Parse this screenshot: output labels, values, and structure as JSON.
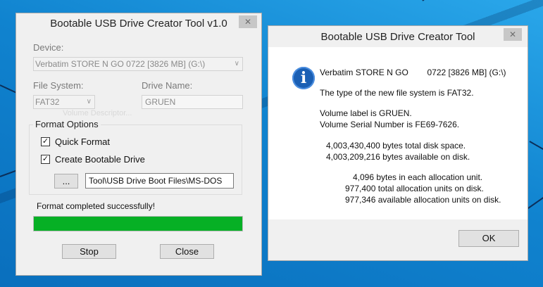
{
  "left_window": {
    "title": "Bootable USB Drive Creator Tool   v1.0",
    "close_glyph": "✕",
    "device_label": "Device:",
    "device_value": "Verbatim STORE N GO        0722 [3826 MB] (G:\\)",
    "filesystem_label": "File System:",
    "filesystem_value": "FAT32",
    "drive_name_label": "Drive Name:",
    "drive_name_value": "GRUEN",
    "ghost_text": "Volume Descriptor...",
    "format_options_title": "Format Options",
    "quick_format_label": "Quick Format",
    "quick_format_checked": true,
    "bootable_label": "Create Bootable Drive",
    "bootable_checked": true,
    "browse_label": "...",
    "boot_path": "Tool\\USB Drive Boot Files\\MS-DOS",
    "status_text": "Format completed successfully!",
    "progress": 1.0,
    "stop_label": "Stop",
    "close_label": "Close",
    "progress_color": "#06b025"
  },
  "right_window": {
    "title": "Bootable USB Drive Creator Tool",
    "close_glyph": "✕",
    "icon": "info-icon",
    "lines": {
      "device": "Verbatim STORE N GO        0722 [3826 MB] (G:\\)",
      "fs_type": "The type of the new file system is FAT32.",
      "volume_label": "Volume label is GRUEN.",
      "serial": "Volume Serial Number is FE69-7626.",
      "total_space": "4,003,430,400 bytes total disk space.",
      "available": "4,003,209,216 bytes available on disk.",
      "alloc_unit": "4,096 bytes in each allocation unit.",
      "total_units": "977,400 total allocation units on disk.",
      "available_units": "977,346 available allocation units on disk."
    },
    "ok_label": "OK"
  }
}
